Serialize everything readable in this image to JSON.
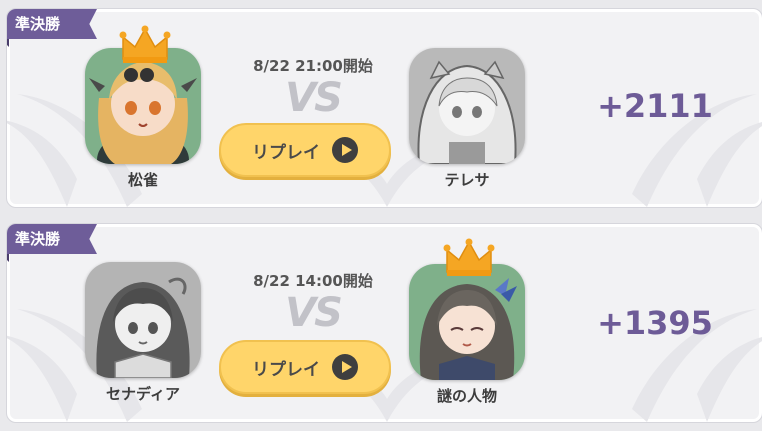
{
  "matches": [
    {
      "round": "準決勝",
      "datetime": "8/22 21:00開始",
      "vs": "VS",
      "replay_label": "リプレイ",
      "left_player": {
        "name": "松雀",
        "winner": true
      },
      "right_player": {
        "name": "テレサ",
        "winner": false
      },
      "score": "+2111"
    },
    {
      "round": "準決勝",
      "datetime": "8/22 14:00開始",
      "vs": "VS",
      "replay_label": "リプレイ",
      "left_player": {
        "name": "セナディア",
        "winner": false
      },
      "right_player": {
        "name": "謎の人物",
        "winner": true
      },
      "score": "+1395"
    }
  ],
  "colors": {
    "badge": "#6e5d99",
    "score": "#6d5b97",
    "crown": "#f5a623",
    "replay_button": "#ffd56a"
  },
  "icons": [
    "crown-icon",
    "play-icon"
  ]
}
